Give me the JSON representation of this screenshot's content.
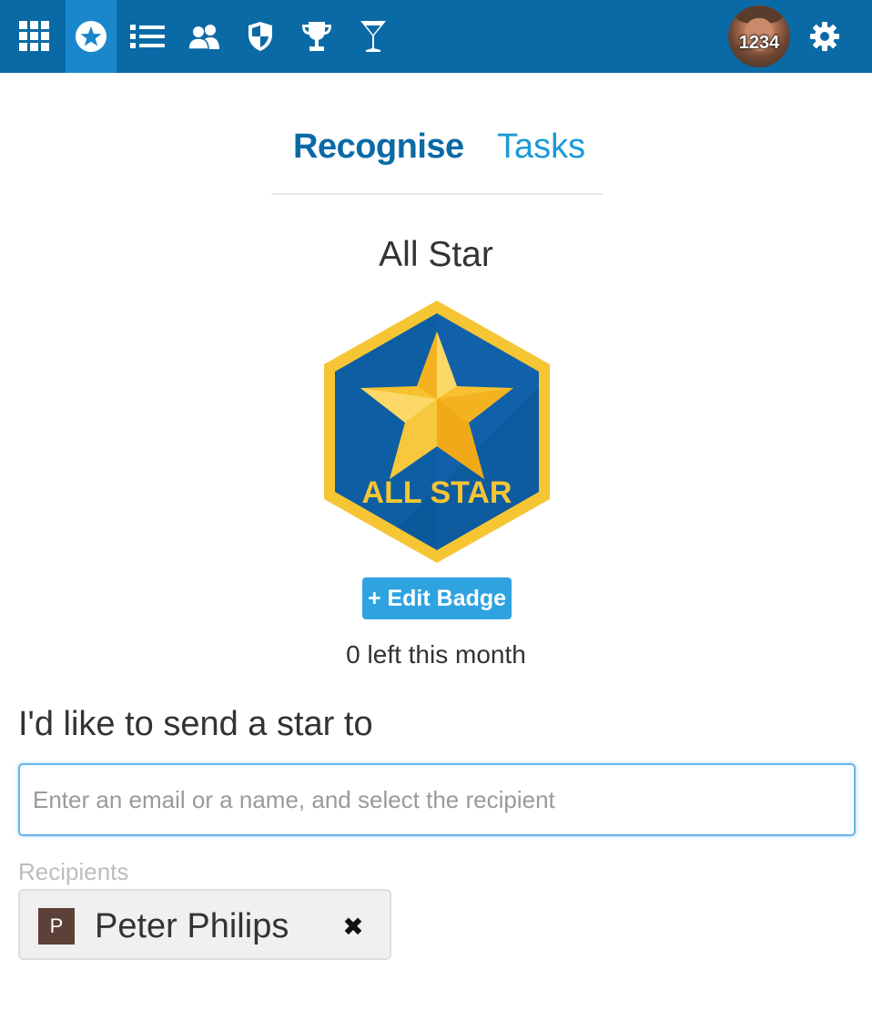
{
  "nav": {
    "icons": [
      "apps-grid-icon",
      "star-badge-icon",
      "list-icon",
      "people-icon",
      "shield-icon",
      "trophy-icon",
      "cocktail-icon"
    ],
    "active_index": 1,
    "user": {
      "points": "1234"
    },
    "settings_icon": "gear-icon"
  },
  "tabs": [
    {
      "label": "Recognise",
      "active": true
    },
    {
      "label": "Tasks",
      "active": false
    }
  ],
  "badge": {
    "title": "All Star",
    "image_text": "ALL STAR",
    "edit_label": "+ Edit Badge",
    "remaining": "0 left this month"
  },
  "send": {
    "label": "I'd like to send a star to",
    "placeholder": "Enter an email or a name, and select the recipient",
    "recipients_label": "Recipients",
    "recipients": [
      {
        "initial": "P",
        "name": "Peter Philips"
      }
    ]
  },
  "colors": {
    "topbar": "#0a6aa6",
    "active_nav": "#1a87cc",
    "accent": "#2ea3e0",
    "badge_blue": "#0d5ea3",
    "badge_gold": "#f5c534"
  }
}
